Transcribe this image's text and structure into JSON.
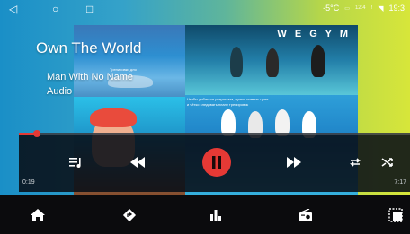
{
  "status_bar": {
    "nav_back_icon": "back-triangle-icon",
    "nav_home_icon": "home-circle-icon",
    "nav_recents_icon": "recents-square-icon",
    "temperature": "-5°C",
    "clock": "19:3",
    "tiny_time": "12:4",
    "tiny_mark": "!"
  },
  "player": {
    "title": "Own The World",
    "artist": "Man With No Name",
    "album": "Audio",
    "elapsed": "0:19",
    "duration": "7:17",
    "progress_fraction": 0.045,
    "accent_color": "#e53935"
  },
  "album_art": {
    "brand_text": "W E G Y M",
    "caption_line_1": "Тренировки для",
    "caption_line_2": "Чтобы добиться результата, нужно ставить цели",
    "caption_line_3": "и чётко следовать плану тренировок"
  },
  "controls": {
    "playlist_icon": "playlist-icon",
    "previous_icon": "rewind-icon",
    "pause_icon": "pause-icon",
    "next_icon": "fast-forward-icon",
    "repeat_icon": "repeat-icon",
    "shuffle_icon": "shuffle-icon"
  },
  "bottom_nav": {
    "items": [
      "home-icon",
      "navigation-icon",
      "equalizer-icon",
      "radio-icon",
      "apps-icon"
    ]
  }
}
